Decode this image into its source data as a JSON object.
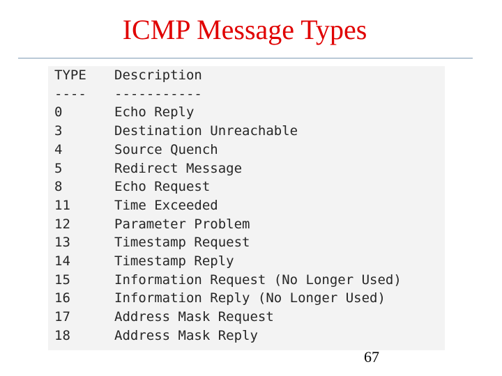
{
  "slide": {
    "title": "ICMP Message Types",
    "page_number": "67"
  },
  "table": {
    "headers": {
      "type": "TYPE",
      "description": "Description"
    },
    "separators": {
      "type": "----",
      "description": "-----------"
    },
    "rows": [
      {
        "type": "0",
        "description": "Echo Reply"
      },
      {
        "type": "3",
        "description": "Destination Unreachable"
      },
      {
        "type": "4",
        "description": "Source Quench"
      },
      {
        "type": "5",
        "description": "Redirect Message"
      },
      {
        "type": "8",
        "description": "Echo Request"
      },
      {
        "type": "11",
        "description": "Time Exceeded"
      },
      {
        "type": "12",
        "description": "Parameter Problem"
      },
      {
        "type": "13",
        "description": "Timestamp Request"
      },
      {
        "type": "14",
        "description": "Timestamp Reply"
      },
      {
        "type": "15",
        "description": "Information Request (No Longer Used)"
      },
      {
        "type": "16",
        "description": "Information Reply (No Longer Used)"
      },
      {
        "type": "17",
        "description": "Address Mask Request"
      },
      {
        "type": "18",
        "description": "Address Mask Reply"
      }
    ]
  },
  "colors": {
    "title": "#e00000",
    "rule": "#7f9bb5",
    "code_background": "#f3f3f3",
    "code_text": "#262626"
  }
}
